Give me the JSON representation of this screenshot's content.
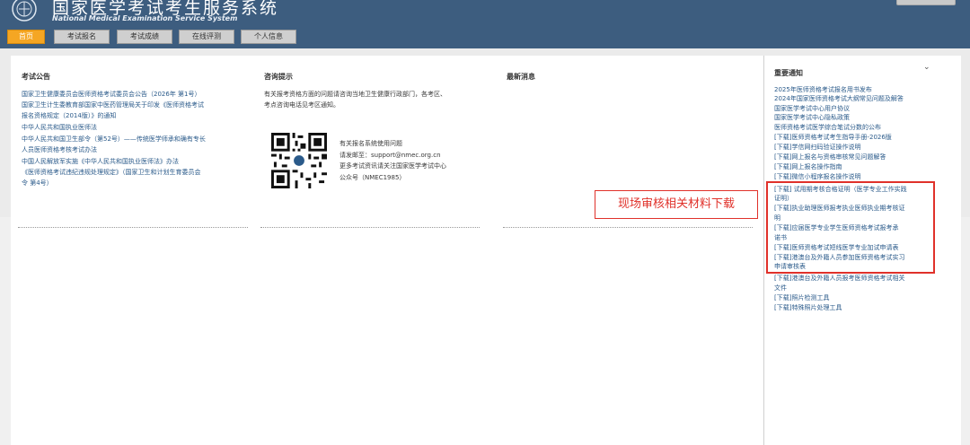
{
  "header": {
    "title": "国家医学考试考生服务系统",
    "subtitle": "National Medical Examination Service System"
  },
  "nav": [
    {
      "label": "首页",
      "active": true
    },
    {
      "label": "考试报名",
      "active": false
    },
    {
      "label": "考试成绩",
      "active": false
    },
    {
      "label": "在线评测",
      "active": false
    },
    {
      "label": "个人信息",
      "active": false
    }
  ],
  "announcements": {
    "title": "考试公告",
    "lines": [
      "国家卫生健康委员会医师资格考试委员会公告（2026年 第1号）",
      "国家卫生计生委教育部国家中医药管理局关于印发《医师资格考试",
      "报名资格规定（2014版）》的通知",
      "中华人民共和国执业医师法",
      "中华人民共和国卫生部令（第52号）——传统医学师承和确有专长",
      "人员医师资格考核考试办法",
      "中国人民解放军实施《中华人民共和国执业医师法》办法",
      "《医师资格考试违纪违规处理规定》（国家卫生和计划生育委员会",
      "令 第4号）"
    ]
  },
  "consult": {
    "title": "咨询提示",
    "lines": [
      "有关报考资格方面的问题请咨询当地卫生健康行政部门，各考区、",
      "考点咨询电话见考区通知。"
    ],
    "contact_lines": [
      "有关报名系统使用问题",
      "请发邮至：support@nmec.org.cn",
      "更多考试资讯请关注国家医学考试中心",
      "公众号（NMEC1985）"
    ]
  },
  "news": {
    "title": "最新消息"
  },
  "notices": {
    "title": "重要通知",
    "items": [
      "2025年医师资格考试报名用书发布",
      "2024年国家医师资格考试大纲常见问题及解答",
      "国家医学考试中心用户协议",
      "国家医学考试中心隐私政策",
      "医师资格考试医学综合笔试分数的公布",
      "[下载]医师资格考试考生指导手册-2026版",
      "[下载]学信网扫码验证操作说明",
      "[下载]网上报名与资格审核常见问题解答",
      "[下载]网上报名操作指南",
      "[下载]微信小程序报名操作说明"
    ],
    "boxed_items": [
      "[下载] 试用期考核合格证明（医学专业工作实践",
      "证明）",
      "[下载]执业助理医师报考执业医师执业期考核证",
      "明",
      "[下载]应届医学专业学生医师资格考试报考承",
      "诺书",
      "[下载]医师资格考试短线医学专业加试申请表",
      "[下载]港澳台及外籍人员参加医师资格考试实习",
      "申请审核表"
    ],
    "after_items": [
      "[下载]港澳台及外籍人员报考医师资格考试相关",
      "文件",
      "[下载]照片检测工具",
      "[下载]特殊照片处理工具"
    ]
  },
  "annotation": {
    "label": "现场审核相关材料下载",
    "color": "#e0312a"
  },
  "colors": {
    "header": "#3d5d7f",
    "nav_active": "#f5a623",
    "link": "#2a5a8a"
  }
}
